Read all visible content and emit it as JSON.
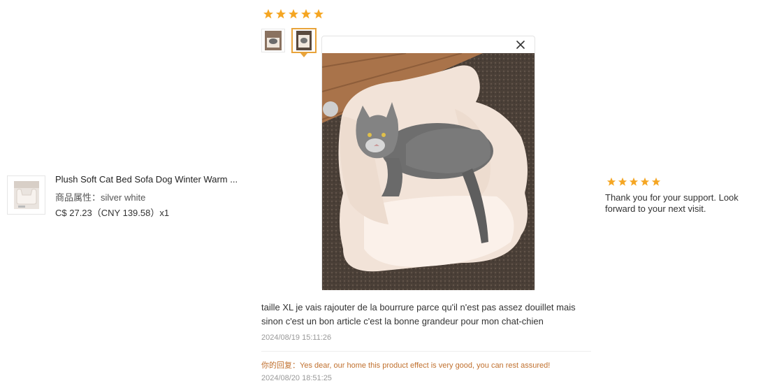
{
  "product": {
    "title": "Plush Soft Cat Bed Sofa Dog Winter Warm ...",
    "attribute": "商品属性：silver white",
    "price": "C$ 27.23（CNY  139.58）x1"
  },
  "review": {
    "rating": 5,
    "text": "taille XL je vais rajouter de la bourrure parce qu'il n'est pas assez douillet mais sinon c'est un bon article c'est la bonne grandeur pour mon chat-chien",
    "date": "2024/08/19 15:11:26",
    "reply_label": "你的回复：",
    "reply_text": "Yes dear, our home this product effect is very good, you can rest assured!",
    "reply_date": "2024/08/20 18:51:25"
  },
  "seller": {
    "rating": 5,
    "note": "Thank you for your support. Look forward to your next visit."
  },
  "colors": {
    "star": "#f5a623",
    "accent": "#e8a33a",
    "reply": "#c0702e"
  },
  "icons": {
    "close": "close-icon",
    "star": "star-icon"
  }
}
